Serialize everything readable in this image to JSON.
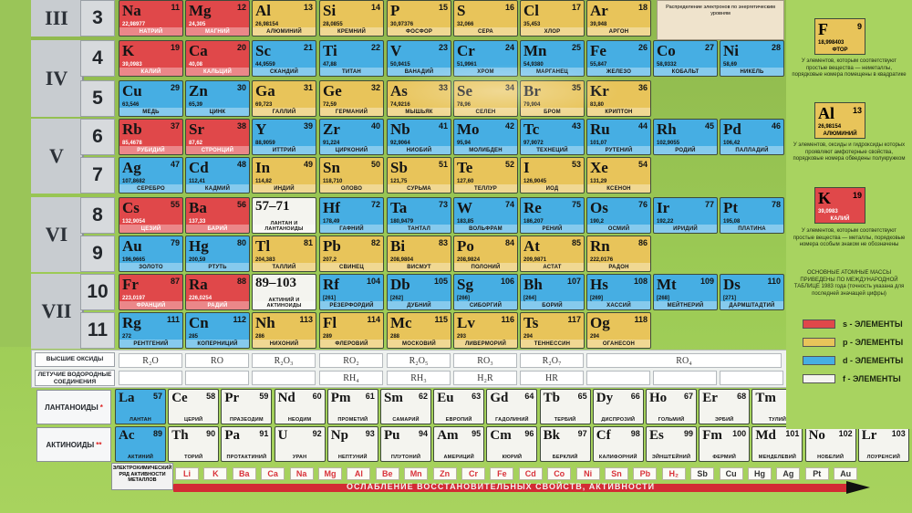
{
  "periods": [
    {
      "roman": "III",
      "rows": [
        "3"
      ]
    },
    {
      "roman": "IV",
      "rows": [
        "4",
        "5"
      ]
    },
    {
      "roman": "V",
      "rows": [
        "6",
        "7"
      ]
    },
    {
      "roman": "VI",
      "rows": [
        "8",
        "9"
      ]
    },
    {
      "roman": "VII",
      "rows": [
        "10",
        "11"
      ]
    }
  ],
  "elements": [
    {
      "sym": "Na",
      "num": "11",
      "mass": "22,98977",
      "name": "НАТРИЙ",
      "type": "s",
      "row": 0,
      "col": 0
    },
    {
      "sym": "Mg",
      "num": "12",
      "mass": "24,305",
      "name": "МАГНИЙ",
      "type": "s",
      "row": 0,
      "col": 1
    },
    {
      "sym": "Al",
      "num": "13",
      "mass": "26,98154",
      "name": "АЛЮМИНИЙ",
      "type": "p",
      "row": 0,
      "col": 2
    },
    {
      "sym": "Si",
      "num": "14",
      "mass": "28,0855",
      "name": "КРЕМНИЙ",
      "type": "p",
      "row": 0,
      "col": 3
    },
    {
      "sym": "P",
      "num": "15",
      "mass": "30,97376",
      "name": "ФОСФОР",
      "type": "p",
      "row": 0,
      "col": 4
    },
    {
      "sym": "S",
      "num": "16",
      "mass": "32,066",
      "name": "СЕРА",
      "type": "p",
      "row": 0,
      "col": 5
    },
    {
      "sym": "Cl",
      "num": "17",
      "mass": "35,453",
      "name": "ХЛОР",
      "type": "p",
      "row": 0,
      "col": 6
    },
    {
      "sym": "Ar",
      "num": "18",
      "mass": "39,948",
      "name": "АРГОН",
      "type": "p",
      "row": 0,
      "col": 7
    },
    {
      "sym": "K",
      "num": "19",
      "mass": "39,0983",
      "name": "КАЛИЙ",
      "type": "s",
      "row": 1,
      "col": 0
    },
    {
      "sym": "Ca",
      "num": "20",
      "mass": "40,08",
      "name": "КАЛЬЦИЙ",
      "type": "s",
      "row": 1,
      "col": 1
    },
    {
      "sym": "Sc",
      "num": "21",
      "mass": "44,9559",
      "name": "СКАНДИЙ",
      "type": "d",
      "row": 1,
      "col": 2
    },
    {
      "sym": "Ti",
      "num": "22",
      "mass": "47,88",
      "name": "ТИТАН",
      "type": "d",
      "row": 1,
      "col": 3
    },
    {
      "sym": "V",
      "num": "23",
      "mass": "50,9415",
      "name": "ВАНАДИЙ",
      "type": "d",
      "row": 1,
      "col": 4
    },
    {
      "sym": "Cr",
      "num": "24",
      "mass": "51,9961",
      "name": "ХРОМ",
      "type": "d",
      "row": 1,
      "col": 5
    },
    {
      "sym": "Mn",
      "num": "25",
      "mass": "54,9380",
      "name": "МАРГАНЕЦ",
      "type": "d",
      "row": 1,
      "col": 6
    },
    {
      "sym": "Fe",
      "num": "26",
      "mass": "55,847",
      "name": "ЖЕЛЕЗО",
      "type": "d",
      "row": 1,
      "col": 7
    },
    {
      "sym": "Co",
      "num": "27",
      "mass": "58,9332",
      "name": "КОБАЛЬТ",
      "type": "d",
      "row": 1,
      "col": 8
    },
    {
      "sym": "Ni",
      "num": "28",
      "mass": "58,69",
      "name": "НИКЕЛЬ",
      "type": "d",
      "row": 1,
      "col": 9
    },
    {
      "sym": "Cu",
      "num": "29",
      "mass": "63,546",
      "name": "МЕДЬ",
      "type": "d",
      "row": 2,
      "col": 0
    },
    {
      "sym": "Zn",
      "num": "30",
      "mass": "65,39",
      "name": "ЦИНК",
      "type": "d",
      "row": 2,
      "col": 1
    },
    {
      "sym": "Ga",
      "num": "31",
      "mass": "69,723",
      "name": "ГАЛЛИЙ",
      "type": "p",
      "row": 2,
      "col": 2
    },
    {
      "sym": "Ge",
      "num": "32",
      "mass": "72,59",
      "name": "ГЕРМАНИЙ",
      "type": "p",
      "row": 2,
      "col": 3
    },
    {
      "sym": "As",
      "num": "33",
      "mass": "74,9216",
      "name": "МЫШЬЯК",
      "type": "p",
      "row": 2,
      "col": 4
    },
    {
      "sym": "Se",
      "num": "34",
      "mass": "78,96",
      "name": "СЕЛЕН",
      "type": "p",
      "row": 2,
      "col": 5
    },
    {
      "sym": "Br",
      "num": "35",
      "mass": "79,904",
      "name": "БРОМ",
      "type": "p",
      "row": 2,
      "col": 6
    },
    {
      "sym": "Kr",
      "num": "36",
      "mass": "83,80",
      "name": "КРИПТОН",
      "type": "p",
      "row": 2,
      "col": 7
    },
    {
      "sym": "Rb",
      "num": "37",
      "mass": "85,4678",
      "name": "РУБИДИЙ",
      "type": "s",
      "row": 3,
      "col": 0
    },
    {
      "sym": "Sr",
      "num": "38",
      "mass": "87,62",
      "name": "СТРОНЦИЙ",
      "type": "s",
      "row": 3,
      "col": 1
    },
    {
      "sym": "Y",
      "num": "39",
      "mass": "88,9059",
      "name": "ИТТРИЙ",
      "type": "d",
      "row": 3,
      "col": 2
    },
    {
      "sym": "Zr",
      "num": "40",
      "mass": "91,224",
      "name": "ЦИРКОНИЙ",
      "type": "d",
      "row": 3,
      "col": 3
    },
    {
      "sym": "Nb",
      "num": "41",
      "mass": "92,9064",
      "name": "НИОБИЙ",
      "type": "d",
      "row": 3,
      "col": 4
    },
    {
      "sym": "Mo",
      "num": "42",
      "mass": "95,94",
      "name": "МОЛИБДЕН",
      "type": "d",
      "row": 3,
      "col": 5
    },
    {
      "sym": "Tc",
      "num": "43",
      "mass": "97,9072",
      "name": "ТЕХНЕЦИЙ",
      "type": "d",
      "row": 3,
      "col": 6
    },
    {
      "sym": "Ru",
      "num": "44",
      "mass": "101,07",
      "name": "РУТЕНИЙ",
      "type": "d",
      "row": 3,
      "col": 7
    },
    {
      "sym": "Rh",
      "num": "45",
      "mass": "102,9055",
      "name": "РОДИЙ",
      "type": "d",
      "row": 3,
      "col": 8
    },
    {
      "sym": "Pd",
      "num": "46",
      "mass": "106,42",
      "name": "ПАЛЛАДИЙ",
      "type": "d",
      "row": 3,
      "col": 9
    },
    {
      "sym": "Ag",
      "num": "47",
      "mass": "107,8682",
      "name": "СЕРЕБРО",
      "type": "d",
      "row": 4,
      "col": 0
    },
    {
      "sym": "Cd",
      "num": "48",
      "mass": "112,41",
      "name": "КАДМИЙ",
      "type": "d",
      "row": 4,
      "col": 1
    },
    {
      "sym": "In",
      "num": "49",
      "mass": "114,82",
      "name": "ИНДИЙ",
      "type": "p",
      "row": 4,
      "col": 2
    },
    {
      "sym": "Sn",
      "num": "50",
      "mass": "118,710",
      "name": "ОЛОВО",
      "type": "p",
      "row": 4,
      "col": 3
    },
    {
      "sym": "Sb",
      "num": "51",
      "mass": "121,75",
      "name": "СУРЬМА",
      "type": "p",
      "row": 4,
      "col": 4
    },
    {
      "sym": "Te",
      "num": "52",
      "mass": "127,60",
      "name": "ТЕЛЛУР",
      "type": "p",
      "row": 4,
      "col": 5
    },
    {
      "sym": "I",
      "num": "53",
      "mass": "126,9045",
      "name": "ИОД",
      "type": "p",
      "row": 4,
      "col": 6
    },
    {
      "sym": "Xe",
      "num": "54",
      "mass": "131,29",
      "name": "КСЕНОН",
      "type": "p",
      "row": 4,
      "col": 7
    },
    {
      "sym": "Cs",
      "num": "55",
      "mass": "132,9054",
      "name": "ЦЕЗИЙ",
      "type": "s",
      "row": 5,
      "col": 0
    },
    {
      "sym": "Ba",
      "num": "56",
      "mass": "137,33",
      "name": "БАРИЙ",
      "type": "s",
      "row": 5,
      "col": 1
    },
    {
      "sym": "57–71",
      "num": "",
      "mass": "",
      "name": "ЛАНТАН И ЛАНТАНОИДЫ",
      "type": "f",
      "row": 5,
      "col": 2
    },
    {
      "sym": "Hf",
      "num": "72",
      "mass": "178,49",
      "name": "ГАФНИЙ",
      "type": "d",
      "row": 5,
      "col": 3
    },
    {
      "sym": "Ta",
      "num": "73",
      "mass": "180,9479",
      "name": "ТАНТАЛ",
      "type": "d",
      "row": 5,
      "col": 4
    },
    {
      "sym": "W",
      "num": "74",
      "mass": "183,85",
      "name": "ВОЛЬФРАМ",
      "type": "d",
      "row": 5,
      "col": 5
    },
    {
      "sym": "Re",
      "num": "75",
      "mass": "186,207",
      "name": "РЕНИЙ",
      "type": "d",
      "row": 5,
      "col": 6
    },
    {
      "sym": "Os",
      "num": "76",
      "mass": "190,2",
      "name": "ОСМИЙ",
      "type": "d",
      "row": 5,
      "col": 7
    },
    {
      "sym": "Ir",
      "num": "77",
      "mass": "192,22",
      "name": "ИРИДИЙ",
      "type": "d",
      "row": 5,
      "col": 8
    },
    {
      "sym": "Pt",
      "num": "78",
      "mass": "195,08",
      "name": "ПЛАТИНА",
      "type": "d",
      "row": 5,
      "col": 9
    },
    {
      "sym": "Au",
      "num": "79",
      "mass": "196,9665",
      "name": "ЗОЛОТО",
      "type": "d",
      "row": 6,
      "col": 0
    },
    {
      "sym": "Hg",
      "num": "80",
      "mass": "200,59",
      "name": "РТУТЬ",
      "type": "d",
      "row": 6,
      "col": 1
    },
    {
      "sym": "Tl",
      "num": "81",
      "mass": "204,383",
      "name": "ТАЛЛИЙ",
      "type": "p",
      "row": 6,
      "col": 2
    },
    {
      "sym": "Pb",
      "num": "82",
      "mass": "207,2",
      "name": "СВИНЕЦ",
      "type": "p",
      "row": 6,
      "col": 3
    },
    {
      "sym": "Bi",
      "num": "83",
      "mass": "208,9804",
      "name": "ВИСМУТ",
      "type": "p",
      "row": 6,
      "col": 4
    },
    {
      "sym": "Po",
      "num": "84",
      "mass": "208,9824",
      "name": "ПОЛОНИЙ",
      "type": "p",
      "row": 6,
      "col": 5
    },
    {
      "sym": "At",
      "num": "85",
      "mass": "209,9871",
      "name": "АСТАТ",
      "type": "p",
      "row": 6,
      "col": 6
    },
    {
      "sym": "Rn",
      "num": "86",
      "mass": "222,0176",
      "name": "РАДОН",
      "type": "p",
      "row": 6,
      "col": 7
    },
    {
      "sym": "Fr",
      "num": "87",
      "mass": "223,0197",
      "name": "ФРАНЦИЙ",
      "type": "s",
      "row": 7,
      "col": 0
    },
    {
      "sym": "Ra",
      "num": "88",
      "mass": "226,0254",
      "name": "РАДИЙ",
      "type": "s",
      "row": 7,
      "col": 1
    },
    {
      "sym": "89–103",
      "num": "",
      "mass": "",
      "name": "АКТИНИЙ И АКТИНОИДЫ",
      "type": "f",
      "row": 7,
      "col": 2
    },
    {
      "sym": "Rf",
      "num": "104",
      "mass": "[261]",
      "name": "РЕЗЕРФОРДИЙ",
      "type": "d",
      "row": 7,
      "col": 3
    },
    {
      "sym": "Db",
      "num": "105",
      "mass": "[262]",
      "name": "ДУБНИЙ",
      "type": "d",
      "row": 7,
      "col": 4
    },
    {
      "sym": "Sg",
      "num": "106",
      "mass": "[266]",
      "name": "СИБОРГИЙ",
      "type": "d",
      "row": 7,
      "col": 5
    },
    {
      "sym": "Bh",
      "num": "107",
      "mass": "[264]",
      "name": "БОРИЙ",
      "type": "d",
      "row": 7,
      "col": 6
    },
    {
      "sym": "Hs",
      "num": "108",
      "mass": "[269]",
      "name": "ХАССИЙ",
      "type": "d",
      "row": 7,
      "col": 7
    },
    {
      "sym": "Mt",
      "num": "109",
      "mass": "[268]",
      "name": "МЕЙТНЕРИЙ",
      "type": "d",
      "row": 7,
      "col": 8
    },
    {
      "sym": "Ds",
      "num": "110",
      "mass": "[271]",
      "name": "ДАРМШТАДТИЙ",
      "type": "d",
      "row": 7,
      "col": 9
    },
    {
      "sym": "Rg",
      "num": "111",
      "mass": "272",
      "name": "РЕНТГЕНИЙ",
      "type": "d",
      "row": 8,
      "col": 0
    },
    {
      "sym": "Cn",
      "num": "112",
      "mass": "285",
      "name": "КОПЕРНИЦИЙ",
      "type": "d",
      "row": 8,
      "col": 1
    },
    {
      "sym": "Nh",
      "num": "113",
      "mass": "286",
      "name": "НИХОНИЙ",
      "type": "p",
      "row": 8,
      "col": 2
    },
    {
      "sym": "Fl",
      "num": "114",
      "mass": "289",
      "name": "ФЛЕРОВИЙ",
      "type": "p",
      "row": 8,
      "col": 3
    },
    {
      "sym": "Mc",
      "num": "115",
      "mass": "288",
      "name": "МОСКОВИЙ",
      "type": "p",
      "row": 8,
      "col": 4
    },
    {
      "sym": "Lv",
      "num": "116",
      "mass": "293",
      "name": "ЛИВЕРМОРИЙ",
      "type": "p",
      "row": 8,
      "col": 5
    },
    {
      "sym": "Ts",
      "num": "117",
      "mass": "294",
      "name": "ТЕННЕССИН",
      "type": "p",
      "row": 8,
      "col": 6
    },
    {
      "sym": "Og",
      "num": "118",
      "mass": "294",
      "name": "ОГАНЕСОН",
      "type": "p",
      "row": 8,
      "col": 7
    }
  ],
  "oxides": {
    "label": "ВЫСШИЕ ОКСИДЫ",
    "values": [
      "R₂O",
      "RO",
      "R₂O₃",
      "RO₂",
      "R₂O₅",
      "RO₃",
      "R₂O₇",
      "RO₄"
    ]
  },
  "hydrides": {
    "label": "ЛЕТУЧИЕ ВОДОРОДНЫЕ СОЕДИНЕНИЯ",
    "values": [
      "RH₄",
      "RH₃",
      "H₂R",
      "HR"
    ]
  },
  "lanthanoids": {
    "label": "ЛАНТАНОИДЫ",
    "mark": "*",
    "items": [
      {
        "sym": "La",
        "num": "57",
        "name": "ЛАНТАН"
      },
      {
        "sym": "Ce",
        "num": "58",
        "name": "ЦЕРИЙ"
      },
      {
        "sym": "Pr",
        "num": "59",
        "name": "ПРАЗЕОДИМ"
      },
      {
        "sym": "Nd",
        "num": "60",
        "name": "НЕОДИМ"
      },
      {
        "sym": "Pm",
        "num": "61",
        "name": "ПРОМЕТИЙ"
      },
      {
        "sym": "Sm",
        "num": "62",
        "name": "САМАРИЙ"
      },
      {
        "sym": "Eu",
        "num": "63",
        "name": "ЕВРОПИЙ"
      },
      {
        "sym": "Gd",
        "num": "64",
        "name": "ГАДОЛИНИЙ"
      },
      {
        "sym": "Tb",
        "num": "65",
        "name": "ТЕРБИЙ"
      },
      {
        "sym": "Dy",
        "num": "66",
        "name": "ДИСПРОЗИЙ"
      },
      {
        "sym": "Ho",
        "num": "67",
        "name": "ГОЛЬМИЙ"
      },
      {
        "sym": "Er",
        "num": "68",
        "name": "ЭРБИЙ"
      },
      {
        "sym": "Tm",
        "num": "69",
        "name": "ТУЛИЙ"
      },
      {
        "sym": "Yb",
        "num": "70",
        "name": "ИТТЕРБИЙ"
      },
      {
        "sym": "Lu",
        "num": "71",
        "name": "ЛЮТЕЦИЙ"
      }
    ]
  },
  "actinoids": {
    "label": "АКТИНОИДЫ",
    "mark": "**",
    "items": [
      {
        "sym": "Ac",
        "num": "89",
        "name": "АКТИНИЙ"
      },
      {
        "sym": "Th",
        "num": "90",
        "name": "ТОРИЙ"
      },
      {
        "sym": "Pa",
        "num": "91",
        "name": "ПРОТАКТИНИЙ"
      },
      {
        "sym": "U",
        "num": "92",
        "name": "УРАН"
      },
      {
        "sym": "Np",
        "num": "93",
        "name": "НЕПТУНИЙ"
      },
      {
        "sym": "Pu",
        "num": "94",
        "name": "ПЛУТОНИЙ"
      },
      {
        "sym": "Am",
        "num": "95",
        "name": "АМЕРИЦИЙ"
      },
      {
        "sym": "Cm",
        "num": "96",
        "name": "КЮРИЙ"
      },
      {
        "sym": "Bk",
        "num": "97",
        "name": "БЕРКЛИЙ"
      },
      {
        "sym": "Cf",
        "num": "98",
        "name": "КАЛИФОРНИЙ"
      },
      {
        "sym": "Es",
        "num": "99",
        "name": "ЭЙНШТЕЙНИЙ"
      },
      {
        "sym": "Fm",
        "num": "100",
        "name": "ФЕРМИЙ"
      },
      {
        "sym": "Md",
        "num": "101",
        "name": "МЕНДЕЛЕВИЙ"
      },
      {
        "sym": "No",
        "num": "102",
        "name": "НОБЕЛИЙ"
      },
      {
        "sym": "Lr",
        "num": "103",
        "name": "ЛОУРЕНСИЙ"
      }
    ]
  },
  "activity": {
    "label": "ЭЛЕКТРОХИМИЧЕСКИЙ РЯД АКТИВНОСТИ МЕТАЛЛОВ",
    "metals": [
      {
        "s": "Li",
        "c": "red"
      },
      {
        "s": "K",
        "c": "red"
      },
      {
        "s": "Ba",
        "c": "red"
      },
      {
        "s": "Ca",
        "c": "red"
      },
      {
        "s": "Na",
        "c": "red"
      },
      {
        "s": "Mg",
        "c": "red"
      },
      {
        "s": "Al",
        "c": "red"
      },
      {
        "s": "Be",
        "c": "red"
      },
      {
        "s": "Mn",
        "c": "red"
      },
      {
        "s": "Zn",
        "c": "red"
      },
      {
        "s": "Cr",
        "c": "red"
      },
      {
        "s": "Fe",
        "c": "red"
      },
      {
        "s": "Cd",
        "c": "red"
      },
      {
        "s": "Co",
        "c": "red"
      },
      {
        "s": "Ni",
        "c": "red"
      },
      {
        "s": "Sn",
        "c": "red"
      },
      {
        "s": "Pb",
        "c": "red"
      },
      {
        "s": "H₂",
        "c": "red"
      },
      {
        "s": "Sb",
        "c": "blk"
      },
      {
        "s": "Cu",
        "c": "blk"
      },
      {
        "s": "Hg",
        "c": "blk"
      },
      {
        "s": "Ag",
        "c": "blk"
      },
      {
        "s": "Pt",
        "c": "blk"
      },
      {
        "s": "Au",
        "c": "blk"
      }
    ],
    "arrow_text": "ОСЛАБЛЕНИЕ ВОССТАНОВИТЕЛЬНЫХ СВОЙСТВ, АКТИВНОСТИ"
  },
  "info": {
    "topnote": "Распределение электронов по энергетическим уровням",
    "f_cell": {
      "sym": "F",
      "num": "9",
      "mass": "18,998403",
      "name": "ФТОР"
    },
    "text1": "У элементов, которым соответствуют простые вещества — неметаллы, порядковые номера помещены в квадратике",
    "al_cell": {
      "sym": "Al",
      "num": "13",
      "mass": "26,98154",
      "name": "АЛЮМИНИЙ"
    },
    "text2": "У элементов, оксиды и гидроксиды которых проявляют амфотерные свойства, порядковые номера обведены полукружком",
    "k_cell": {
      "sym": "K",
      "num": "19",
      "mass": "39,0983",
      "name": "КАЛИЙ"
    },
    "text3": "У элементов, которым соответствуют простые вещества — металлы, порядковые номера особым знаком не обозначены",
    "text4": "ОСНОВНЫЕ АТОМНЫЕ МАССЫ ПРИВЕДЕНЫ ПО МЕЖДУНАРОДНОЙ ТАБЛИЦЕ 1983 года (точность указана для последней значащей цифры)"
  },
  "legend": [
    {
      "label": "s - ЭЛЕМЕНТЫ",
      "color": "#e0484a"
    },
    {
      "label": "p - ЭЛЕМЕНТЫ",
      "color": "#e8c45a"
    },
    {
      "label": "d - ЭЛЕМЕНТЫ",
      "color": "#46aee3"
    },
    {
      "label": "f - ЭЛЕМЕНТЫ",
      "color": "#f4f4ef"
    }
  ]
}
